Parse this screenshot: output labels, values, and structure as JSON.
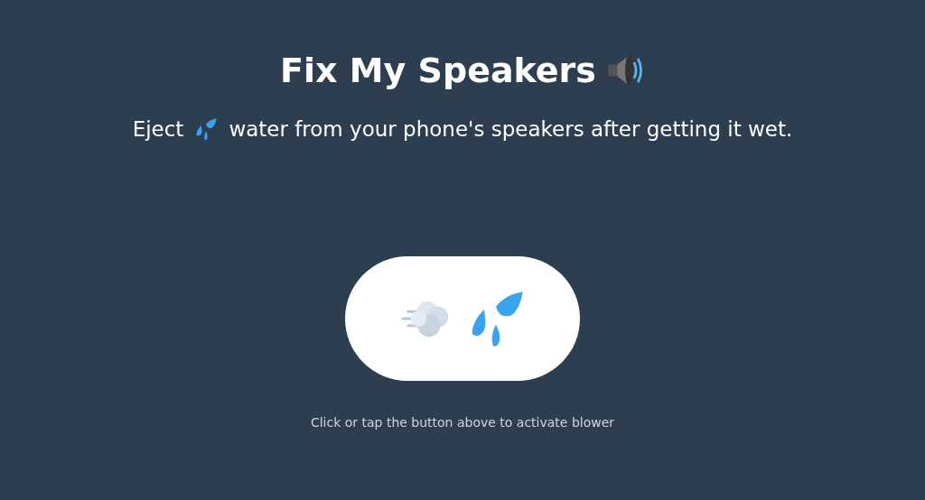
{
  "title": "Fix My Speakers",
  "subtitle": {
    "before": "Eject",
    "after": "water from your phone's speakers after getting it wet."
  },
  "hint": "Click or tap the button above to activate blower"
}
